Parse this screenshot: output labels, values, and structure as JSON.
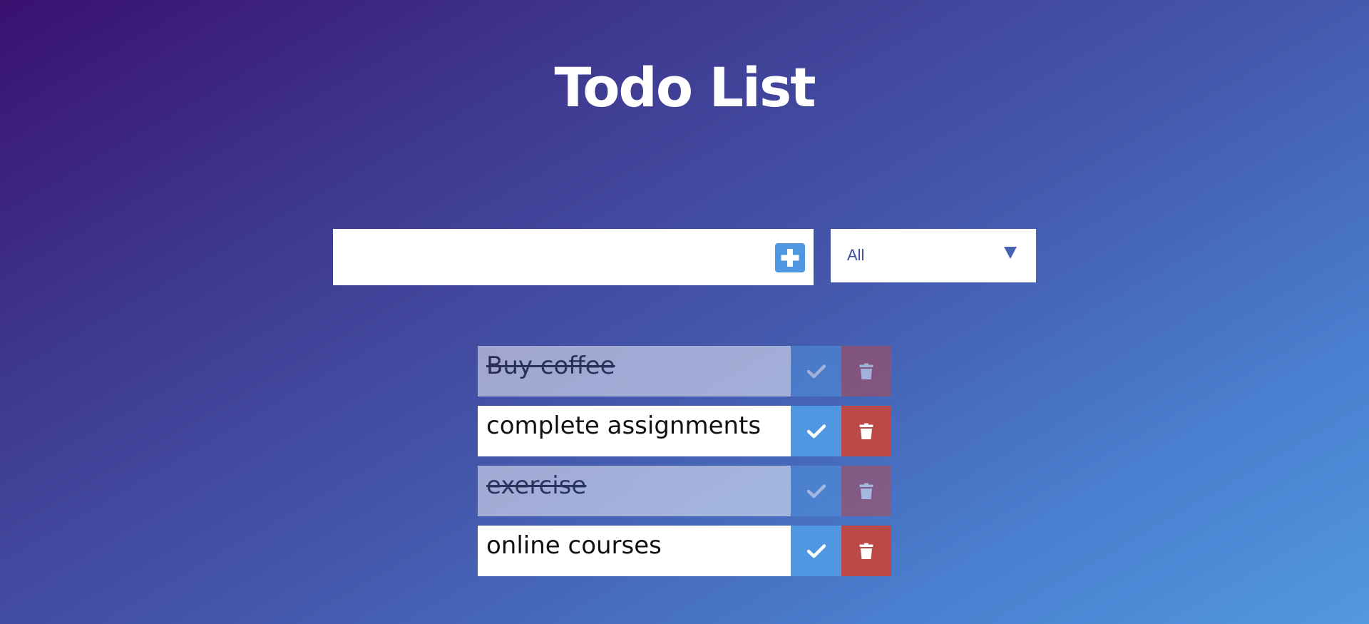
{
  "app": {
    "title": "Todo List"
  },
  "add_form": {
    "input_value": "",
    "input_placeholder": "",
    "add_icon": "plus-square-icon"
  },
  "filter": {
    "selected": "All",
    "arrow_icon": "caret-down-icon"
  },
  "todos": [
    {
      "text": "Buy coffee",
      "completed": true
    },
    {
      "text": "complete assignments",
      "completed": false
    },
    {
      "text": "exercise",
      "completed": true
    },
    {
      "text": "online courses",
      "completed": false
    }
  ],
  "icons": {
    "complete": "check-icon",
    "delete": "trash-icon"
  },
  "colors": {
    "gradient_start": "#3a1170",
    "gradient_end": "#5298e0",
    "accent_blue": "#4f97e0",
    "delete_red": "#bd4848",
    "filter_text": "#3d4f9a"
  }
}
